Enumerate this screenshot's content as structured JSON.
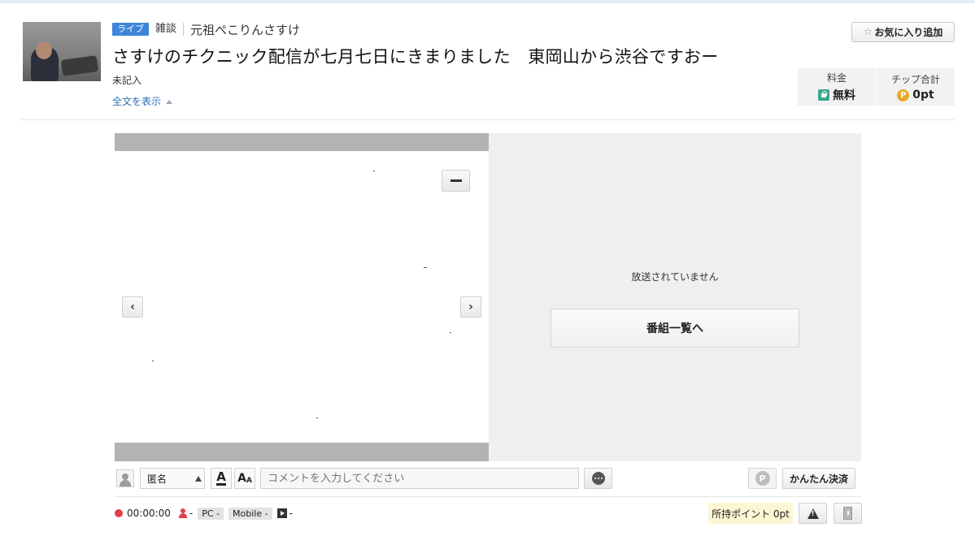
{
  "header": {
    "badge": "ライブ",
    "category": "雑談",
    "author": "元祖ぺこりんさすけ",
    "title": "さすけのチクニック配信が七月七日にきまりました　東岡山から渋谷ですおー",
    "description": "未記入",
    "show_all_label": "全文を表示",
    "favorite_label": "お気に入り追加",
    "price_label": "料金",
    "price_value": "無料",
    "tip_label": "チップ合計",
    "tip_value": "0pt",
    "coin_letter": "P"
  },
  "player": {
    "offline_message": "放送されていません",
    "program_list_button": "番組一覧へ",
    "prev_arrow": "‹",
    "next_arrow": "›"
  },
  "comment": {
    "name_select_value": "匿名",
    "font_color_label": "A",
    "font_size_label": "A",
    "font_size_small": "A",
    "input_placeholder": "コメントを入力してください",
    "p_icon": "P",
    "quick_pay_label": "かんたん決済"
  },
  "status": {
    "timer": "00:00:00",
    "viewers": "-",
    "pc_label": "PC -",
    "mobile_label": "Mobile -",
    "play_count": "-",
    "points_label": "所持ポイント 0pt"
  },
  "colors": {
    "live_badge": "#3d86d8",
    "link": "#2f6fb5",
    "rec": "#e0404a",
    "coin": "#e8a92b",
    "free_lock": "#3aa88a",
    "points_bg": "#fdf6d3"
  }
}
